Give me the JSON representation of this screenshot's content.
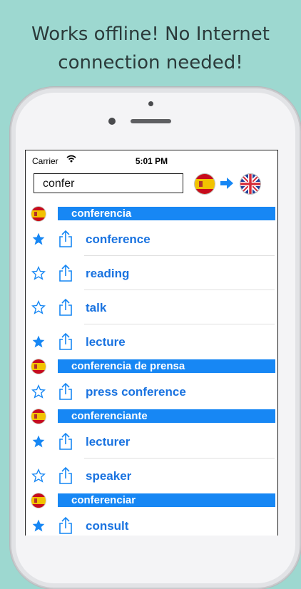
{
  "promo": {
    "line1": "Works offline! No Internet",
    "line2": "connection needed!"
  },
  "status_bar": {
    "carrier": "Carrier",
    "time": "5:01 PM"
  },
  "search": {
    "value": "confer",
    "source_language_icon": "spain-flag-icon",
    "target_language_icon": "uk-flag-icon"
  },
  "colors": {
    "accent": "#1787f4",
    "link": "#1a73e0",
    "background": "#9dd8d0"
  },
  "results": [
    {
      "headword": "conferencia",
      "translations": [
        {
          "text": "conference",
          "starred": true
        },
        {
          "text": "reading",
          "starred": false
        },
        {
          "text": "talk",
          "starred": false
        },
        {
          "text": "lecture",
          "starred": true
        }
      ]
    },
    {
      "headword": "conferencia de prensa",
      "translations": [
        {
          "text": "press conference",
          "starred": false
        }
      ]
    },
    {
      "headword": "conferenciante",
      "translations": [
        {
          "text": "lecturer",
          "starred": true
        },
        {
          "text": "speaker",
          "starred": false
        }
      ]
    },
    {
      "headword": "conferenciar",
      "translations": [
        {
          "text": "consult",
          "starred": true
        }
      ]
    }
  ]
}
